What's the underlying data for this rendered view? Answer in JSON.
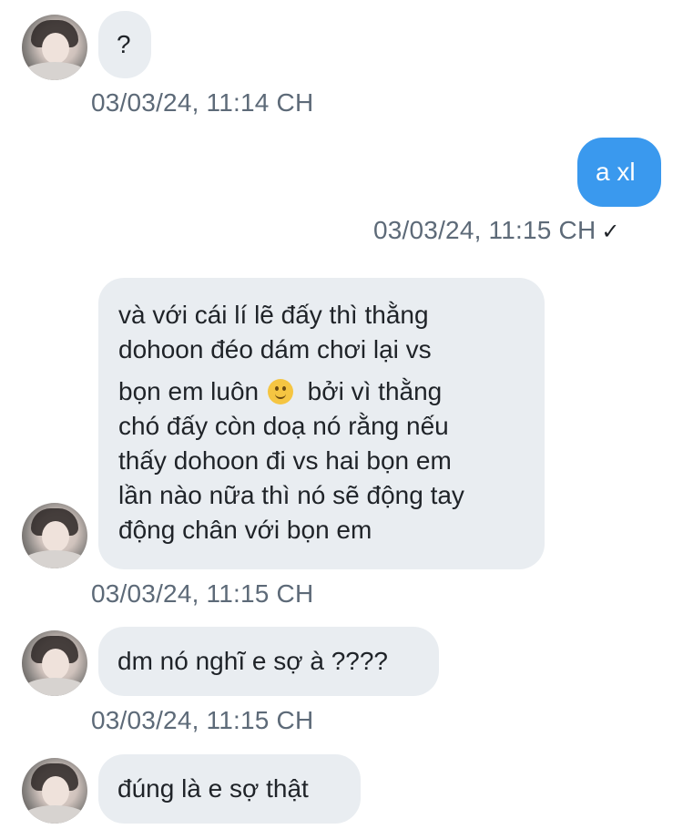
{
  "messages": [
    {
      "text": "?",
      "time": "03/03/24, 11:14 CH"
    },
    {
      "text": "a xl",
      "time": "03/03/24, 11:15 CH",
      "status": "✓"
    },
    {
      "lines": [
        "và với cái lí lẽ đấy thì thằng",
        "dohoon đéo dám chơi lại vs",
        "bọn em luôn",
        "bởi vì thằng",
        "chó đấy còn doạ nó rằng nếu",
        "thấy dohoon đi vs hai bọn em",
        "lần nào nữa thì nó sẽ động tay",
        "động chân với bọn em"
      ],
      "emoji": "slightly-smiling-face",
      "time": "03/03/24, 11:15 CH"
    },
    {
      "text": "dm nó nghĩ e sợ à ????",
      "time": "03/03/24, 11:15 CH"
    },
    {
      "text": "đúng là e sợ thật"
    }
  ],
  "colors": {
    "incoming_bubble": "#e9edf1",
    "outgoing_bubble": "#3a99ee",
    "timestamp": "#5d6a78"
  }
}
